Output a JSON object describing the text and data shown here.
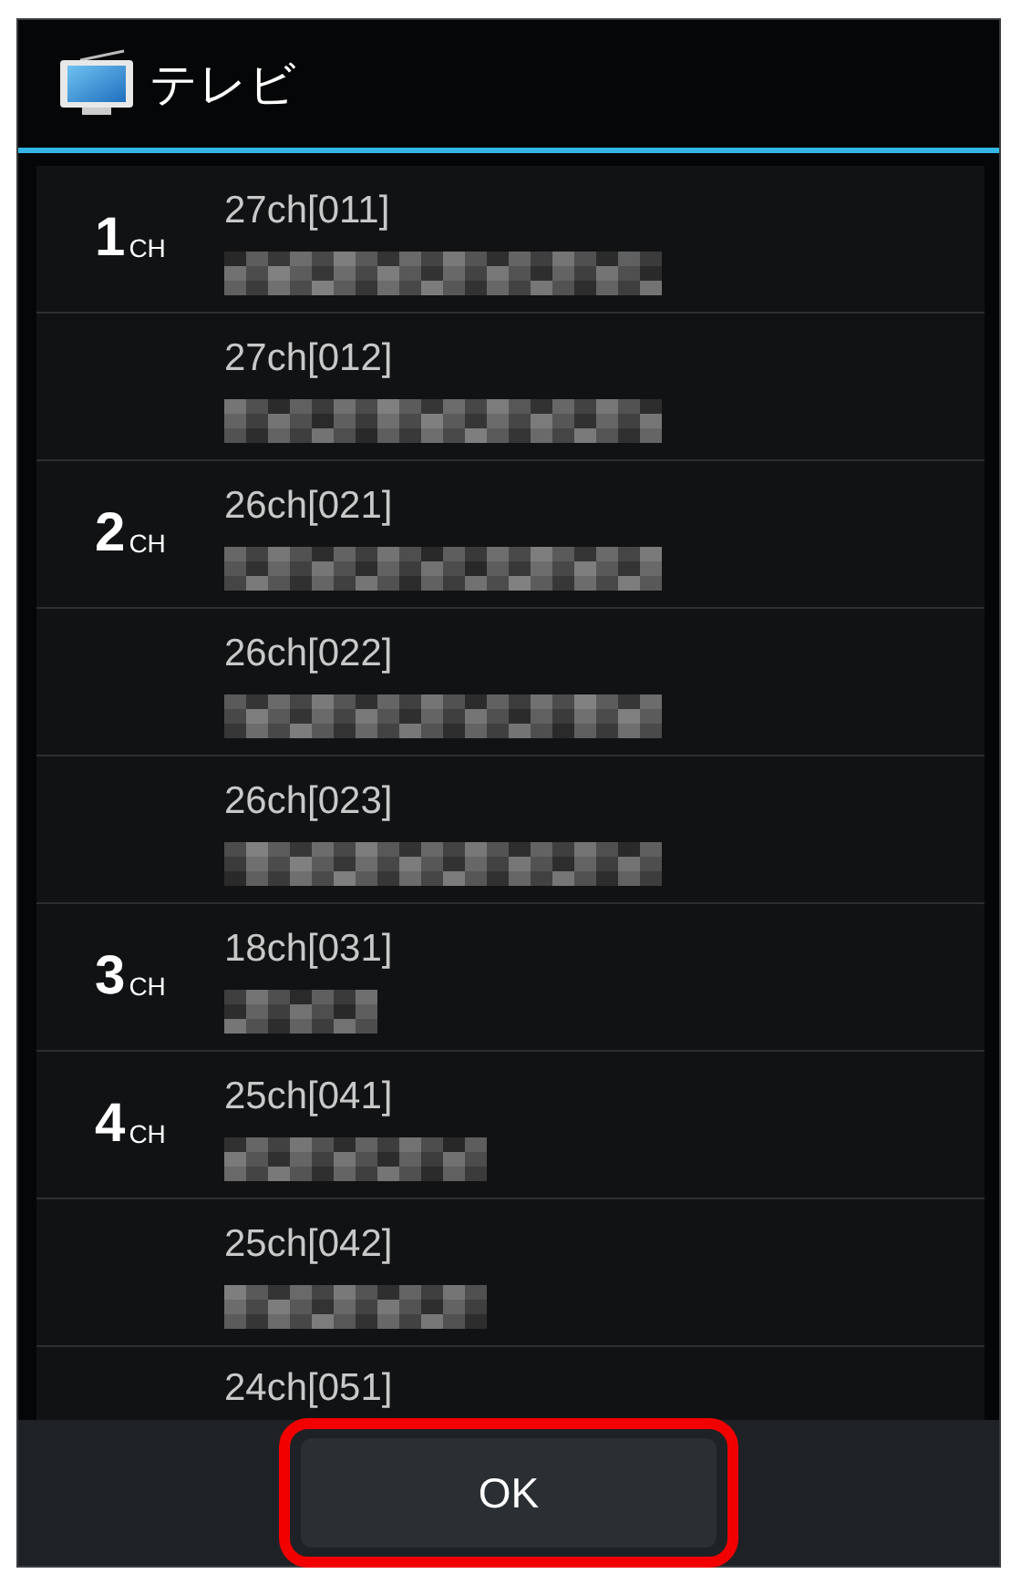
{
  "dialog": {
    "title": "テレビ"
  },
  "channels": [
    {
      "number": "1",
      "unit": "CH",
      "label": "27ch[011]",
      "masked_name": true
    },
    {
      "label": "27ch[012]",
      "masked_name": true
    },
    {
      "number": "2",
      "unit": "CH",
      "label": "26ch[021]",
      "masked_name": true
    },
    {
      "label": "26ch[022]",
      "masked_name": true
    },
    {
      "label": "26ch[023]",
      "masked_name": true
    },
    {
      "number": "3",
      "unit": "CH",
      "label": "18ch[031]",
      "masked_name": true
    },
    {
      "number": "4",
      "unit": "CH",
      "label": "25ch[041]",
      "masked_name": true
    },
    {
      "label": "25ch[042]",
      "masked_name": true
    },
    {
      "label": "24ch[051]",
      "masked_name": false
    }
  ],
  "buttons": [
    {
      "label": "OK",
      "highlighted": true
    }
  ]
}
